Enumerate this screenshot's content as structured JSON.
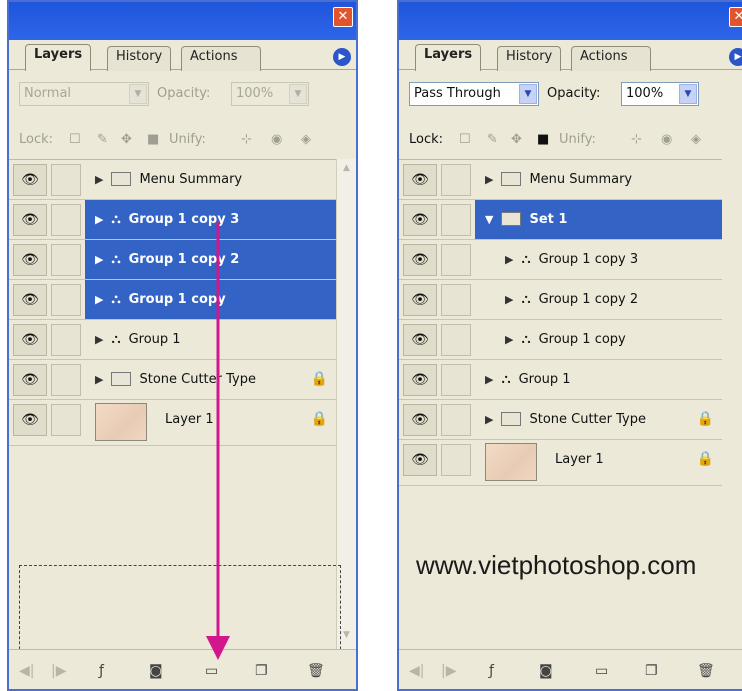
{
  "left_panel": {
    "tabs": [
      "Layers",
      "History",
      "Actions"
    ],
    "blend_mode": "Normal",
    "opacity_label": "Opacity:",
    "opacity_value": "100%",
    "lock_label": "Lock:",
    "unify_label": "Unify:",
    "layers": [
      {
        "name": "Menu Summary",
        "type": "folder",
        "selected": false,
        "locked": false
      },
      {
        "name": "Group 1 copy 3",
        "type": "group",
        "selected": true,
        "locked": false
      },
      {
        "name": "Group 1 copy 2",
        "type": "group",
        "selected": true,
        "locked": false
      },
      {
        "name": "Group 1 copy",
        "type": "group",
        "selected": true,
        "locked": false
      },
      {
        "name": "Group 1",
        "type": "group",
        "selected": false,
        "locked": false
      },
      {
        "name": "Stone Cutter Type",
        "type": "folder",
        "selected": false,
        "locked": true
      },
      {
        "name": "Layer 1",
        "type": "image",
        "selected": false,
        "locked": true
      }
    ]
  },
  "right_panel": {
    "tabs": [
      "Layers",
      "History",
      "Actions"
    ],
    "blend_mode": "Pass Through",
    "opacity_label": "Opacity:",
    "opacity_value": "100%",
    "lock_label": "Lock:",
    "unify_label": "Unify:",
    "layers": [
      {
        "name": "Menu Summary",
        "type": "folder",
        "selected": false,
        "locked": false
      },
      {
        "name": "Set 1",
        "type": "folder-open",
        "selected": true,
        "locked": false
      },
      {
        "name": "Group 1 copy 3",
        "type": "group",
        "selected": false,
        "locked": false
      },
      {
        "name": "Group 1 copy 2",
        "type": "group",
        "selected": false,
        "locked": false
      },
      {
        "name": "Group 1 copy",
        "type": "group",
        "selected": false,
        "locked": false
      },
      {
        "name": "Group 1",
        "type": "group",
        "selected": false,
        "locked": false
      },
      {
        "name": "Stone Cutter Type",
        "type": "folder",
        "selected": false,
        "locked": true
      },
      {
        "name": "Layer 1",
        "type": "image",
        "selected": false,
        "locked": true
      }
    ]
  },
  "watermark": "www.vietphotoshop.com",
  "colors": {
    "selection": "#3263c5",
    "arrow": "#d4168c",
    "titlebar": "#1d55dc"
  }
}
